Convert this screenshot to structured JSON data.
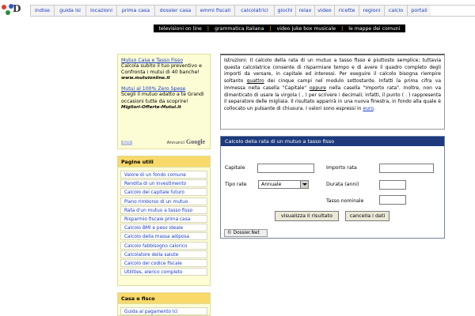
{
  "logo": {
    "text": "D"
  },
  "nav": [
    {
      "label": "indise",
      "w": 30
    },
    {
      "label": "guida lsi",
      "w": 40
    },
    {
      "label": "locazioni",
      "w": 39
    },
    {
      "label": "prima casa",
      "w": 48
    },
    {
      "label": "dossier casa",
      "w": 52
    },
    {
      "label": "emmi fiscali",
      "w": 49
    },
    {
      "label": "calcolatrici",
      "w": 50
    },
    {
      "label": "giochi",
      "w": 27
    },
    {
      "label": "relax",
      "w": 24
    },
    {
      "label": "video",
      "w": 25
    },
    {
      "label": "ricette",
      "w": 31
    },
    {
      "label": "regioni",
      "w": 32
    },
    {
      "label": "calcio",
      "w": 29
    },
    {
      "label": "portali",
      "w": 30
    }
  ],
  "blackbar": [
    "televisioni on line",
    "grammatica italiana",
    "video juke box musicale",
    "le mappe dei comuni"
  ],
  "ads": [
    {
      "title": "Mutuo Casa e Tasso Fisso",
      "text": "Calcola subito il tuo preventivo e Confronta i mutui di 40 banche!",
      "url": "www.mutuionline.it"
    },
    {
      "title": "Mutui al 100% Zero Spese",
      "text": "Scegli il mutuo adatto a te Grandi occasioni tutte da scoprire!",
      "url": "Migliori-Offerte-Mutui.it"
    }
  ],
  "ads_footer": {
    "adv": "ADV",
    "annunci": "Annunci",
    "google": "Google"
  },
  "pagine_utili": {
    "title": "Pagine utili",
    "items": [
      "Valore di un fondo comune",
      "Rendita di un investimento",
      "Calcolo del capitale futuro",
      "Piano rimborso di un mutuo",
      "Rata d'un mutuo a tasso fisso",
      "Risparmio fiscale prima casa",
      "Calcolo BMI e peso ideale",
      "Calcolo della massa adiposa",
      "Calcolo fabbisogno calorico",
      "Calcolatore della salute",
      "Calcolo del codice fiscale",
      "Utilities, elenco completo"
    ]
  },
  "casa_fisco": {
    "title": "Casa e fisco",
    "item": "Guida al pagamento Ici"
  },
  "instructions": {
    "p1": "Istruzioni: Il calcolo della rata di un mutuo a tasso fisso è piuttosto semplice; tuttavia questa calcolatrice consente di risparmiare tempo e di avere il quadro completo degli importi da versare, in capitale ed interessi. Per eseguire il calcolo bisogna riempire soltanto ",
    "quattro": "quattro",
    "p2": " dei cinque campi nel modulo sottostante. Infatti la prima cifra va immessa nella casella \"Capitale\" ",
    "oppure": "oppure",
    "p3": " nella casella \"Importo rata\". Inoltre, non va dimenticato di usare la virgola ( , ) per scrivere i decimali; infatti, il punto ( . ) rappresenta il separatore delle migliaia. Il risultato apparirà in una nuova finestra, in fondo alla quale è collocato un pulsante di chiusura. I valori sono espressi in ",
    "euro": "euro",
    "p4": "."
  },
  "calc": {
    "title": "Calcolo della rata di un mutuo a tasso fisso",
    "capitale": "Capitale",
    "importo_rata": "Importo rata",
    "tipo_rate": "Tipo rate",
    "tipo_rate_value": "Annuale",
    "durata": "Durata (anni)",
    "tasso": "Tasso nominale",
    "btn_visualizza": "visualizza il risultato",
    "btn_cancella": "cancella i dati",
    "copyright": "© Dossier.Net"
  }
}
